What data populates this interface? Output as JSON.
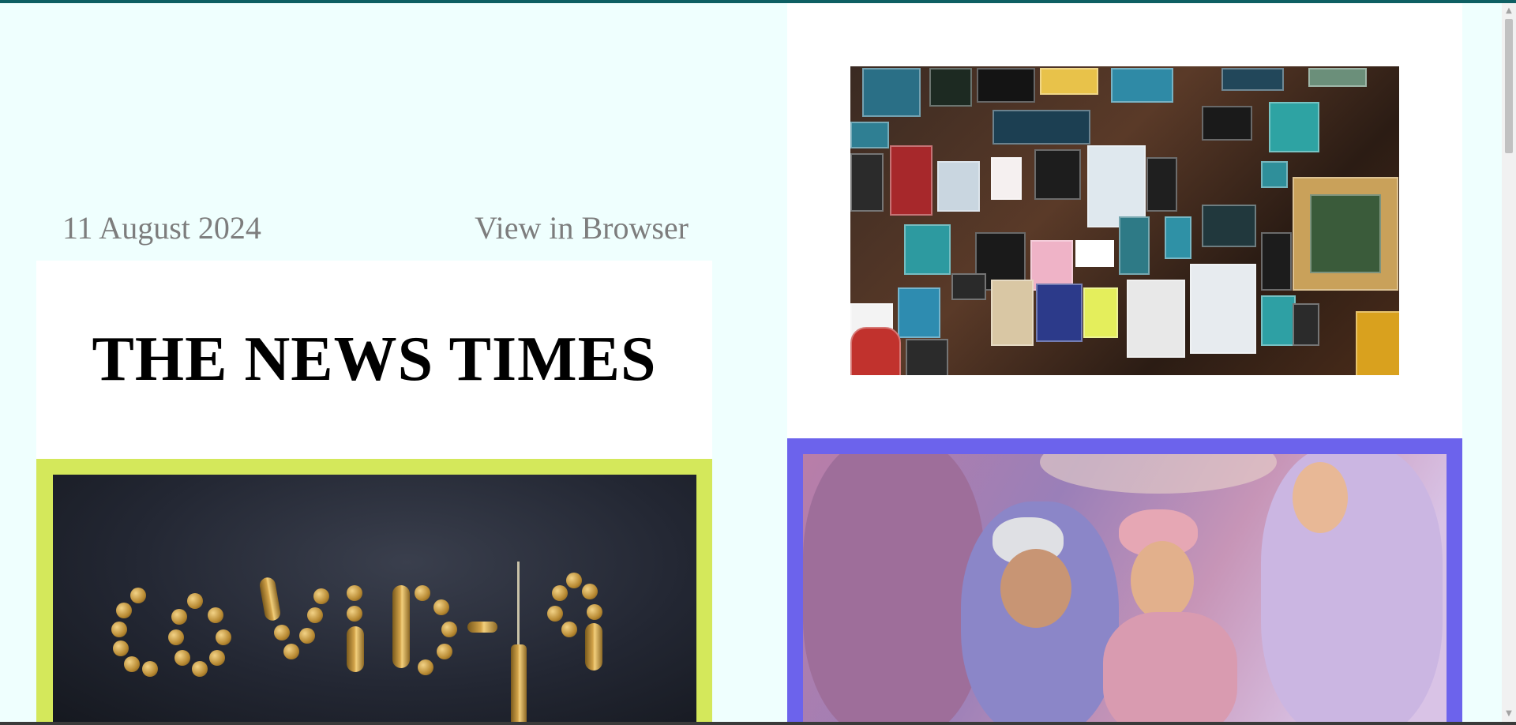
{
  "header": {
    "date": "11 August 2024",
    "view_in_browser": "View in Browser"
  },
  "masthead": {
    "title": "THE NEWS TIMES"
  },
  "images": {
    "covid": {
      "caption": "COVID-19"
    },
    "posters": {},
    "wedding": {}
  },
  "colors": {
    "top_bar": "#0e5f63",
    "page_bg": "#effffe",
    "covid_frame": "#d4e85b",
    "wedding_frame": "#6c63ec"
  },
  "scrollbar": {
    "up_icon": "triangle-up-icon",
    "down_icon": "triangle-down-icon"
  }
}
